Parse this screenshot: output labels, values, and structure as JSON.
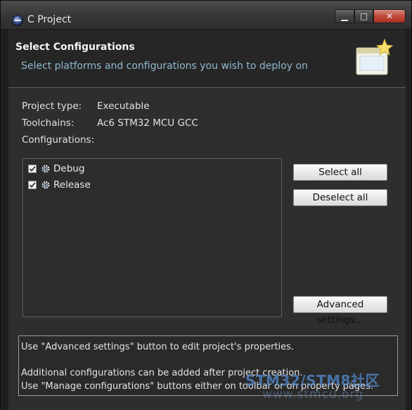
{
  "window": {
    "title": "C Project",
    "minimize_glyph": "▁",
    "maximize_glyph": "□",
    "close_glyph": "✕"
  },
  "header": {
    "title": "Select Configurations",
    "subtitle": "Select platforms and configurations you wish to deploy on"
  },
  "info": {
    "project_type_label": "Project type:",
    "project_type_value": "Executable",
    "toolchains_label": "Toolchains:",
    "toolchains_value": "Ac6 STM32 MCU GCC",
    "configurations_label": "Configurations:"
  },
  "configurations": [
    {
      "label": "Debug",
      "checked": true
    },
    {
      "label": "Release",
      "checked": true
    }
  ],
  "buttons": {
    "select_all": "Select all",
    "deselect_all": "Deselect all",
    "advanced_settings": "Advanced settings..."
  },
  "hints": [
    "Use \"Advanced settings\" button to edit project's properties.",
    "Additional configurations can be added after project creation.",
    "Use \"Manage configurations\" buttons either on toolbar or on property pages."
  ],
  "watermark": {
    "main": "STM32/STM8社区",
    "sub": "www.stmcu.org"
  },
  "colors": {
    "background": "#2e2e2e",
    "subtitle": "#8fb9cf",
    "close_button": "#c0493a"
  }
}
